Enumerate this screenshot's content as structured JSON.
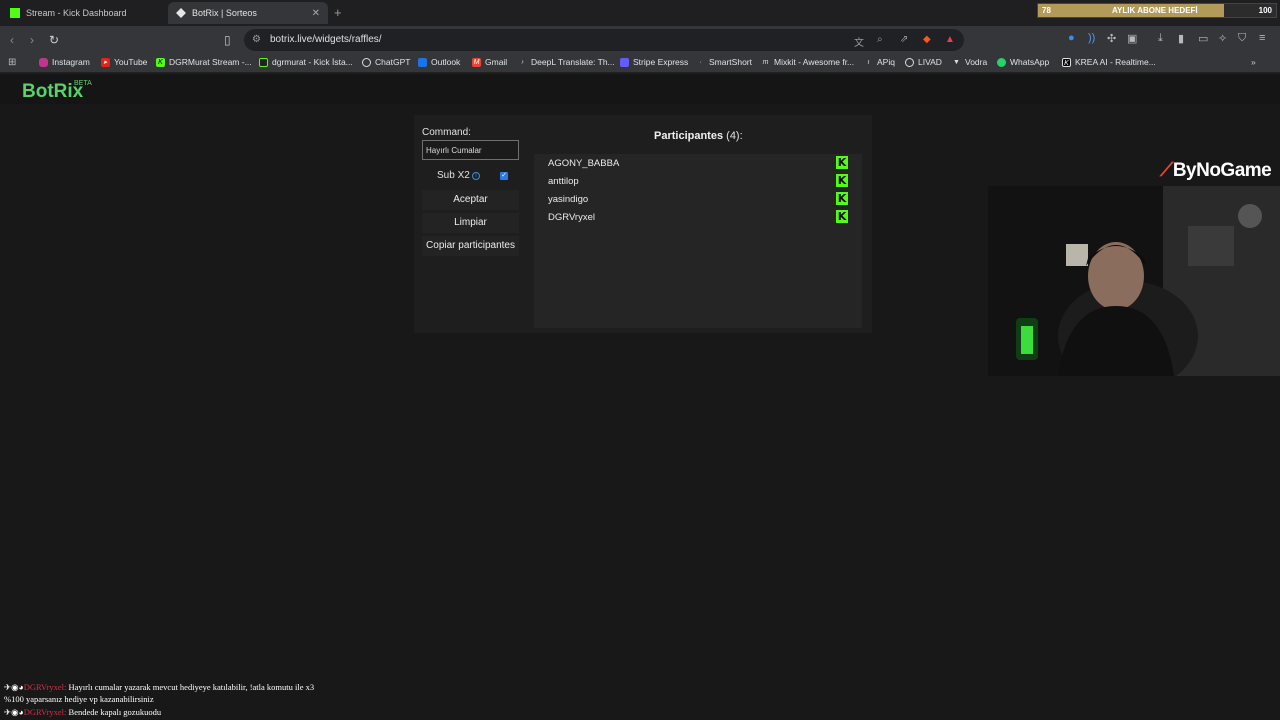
{
  "browser": {
    "tabs": [
      {
        "title": "Stream - Kick Dashboard"
      },
      {
        "title": "BotRix | Sorteos"
      }
    ],
    "url": "botrix.live/widgets/raffles/",
    "bookmarks": [
      "Instagram",
      "YouTube",
      "DGRMurat Stream -...",
      "dgrmurat - Kick İsta...",
      "ChatGPT",
      "Outlook",
      "Gmail",
      "DeepL Translate: Th...",
      "Stripe Express",
      "SmartShort",
      "Mixkit - Awesome fr...",
      "APiq",
      "LIVAD",
      "Vodra",
      "WhatsApp",
      "KREA AI - Realtime..."
    ]
  },
  "goal": {
    "current": "78",
    "label": "AYLIK ABONE HEDEFİ",
    "target": "100",
    "progress_fraction": 0.78
  },
  "app": {
    "brand": "BotRix",
    "badge": "BETA"
  },
  "raffle": {
    "command_label": "Command:",
    "command_value": "Hayırlı Cumalar",
    "sub_label": "Sub X2",
    "sub_checked": true,
    "accept_label": "Aceptar",
    "clear_label": "Limpiar",
    "copy_label": "Copiar participantes",
    "participants_title": "Participantes",
    "participants_count": "(4):",
    "participants": [
      "AGONY_BABBA",
      "anttilop",
      "yasindigo",
      "DGRVryxel"
    ]
  },
  "overlay": {
    "sponsor_logo": "ByNoGame",
    "chat": [
      {
        "user": "DGRVryxel:",
        "text": "Hayırlı cumalar yazarak mevcut hediyeye katılabilir, !atla komutu ile x3"
      },
      {
        "user": "",
        "text": "%100 yaparsanız hediye vp kazanabilirsiniz"
      },
      {
        "user": "DGRVryxel:",
        "text": "Bendede kapalı gozukuodu"
      }
    ]
  },
  "colors": {
    "accent": "#57d36a",
    "kick_green": "#53fc18",
    "chat_user": "#d32f4a"
  }
}
